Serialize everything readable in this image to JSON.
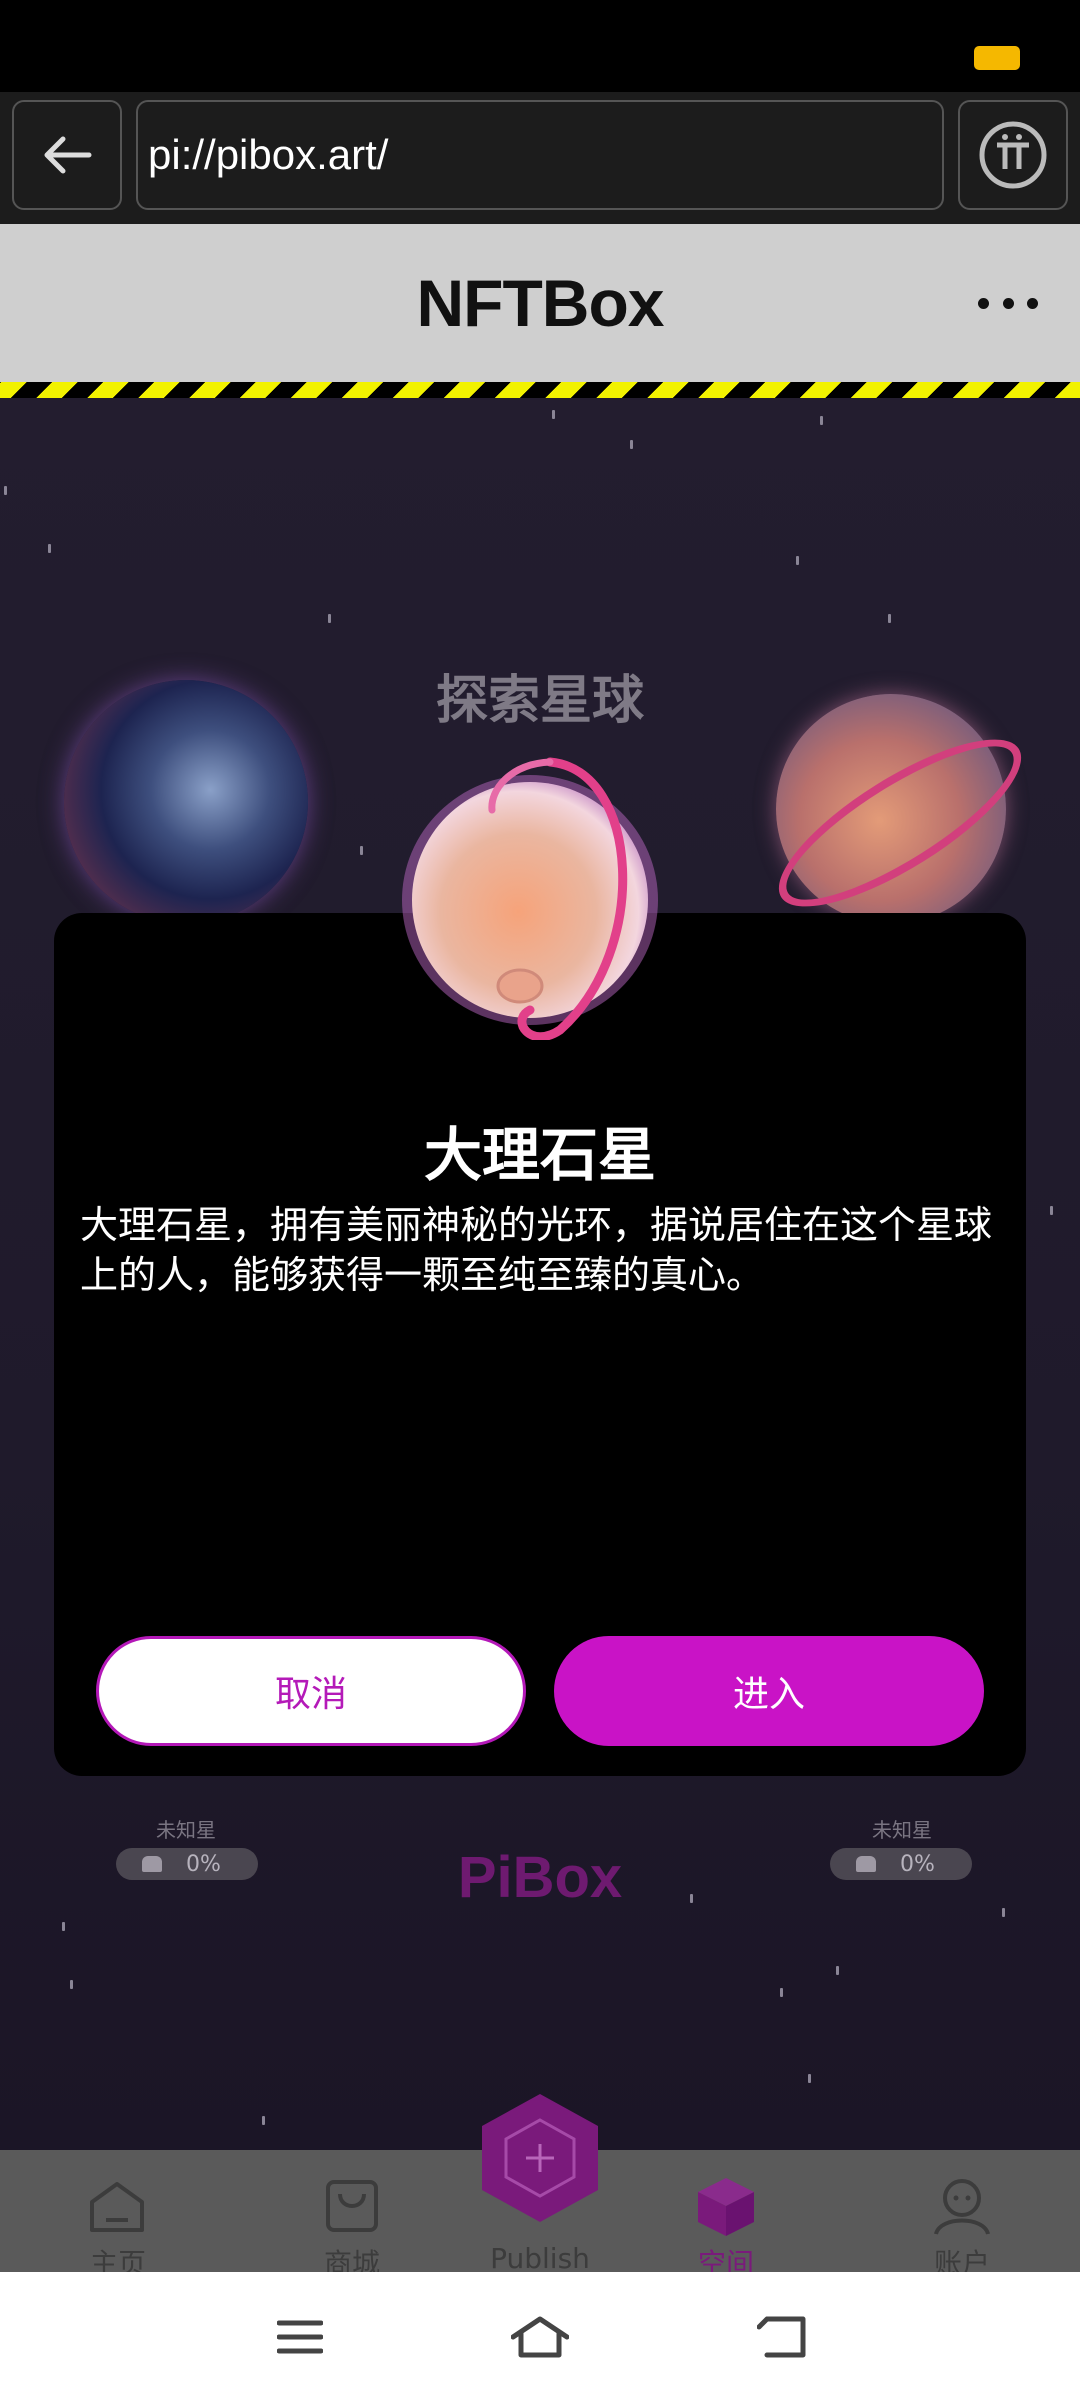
{
  "browser": {
    "url": "pi://pibox.art/"
  },
  "header": {
    "title": "NFTBox"
  },
  "space": {
    "section_title": "探索星球",
    "left_planet": {
      "label": "未知星",
      "progress": "0%"
    },
    "right_planet": {
      "label": "未知星",
      "progress": "0%"
    },
    "logo": "PiBox"
  },
  "modal": {
    "title": "大理石星",
    "description": "大理石星，拥有美丽神秘的光环，据说居住在这个星球上的人，能够获得一颗至纯至臻的真心。",
    "cancel_label": "取消",
    "enter_label": "进入"
  },
  "tabs": [
    {
      "label": "主页",
      "icon": "home-icon"
    },
    {
      "label": "商城",
      "icon": "shopping-bag-icon"
    },
    {
      "label": "Publish",
      "icon": "plus-hexagon-icon"
    },
    {
      "label": "空间",
      "icon": "cube-icon",
      "active": true
    },
    {
      "label": "账户",
      "icon": "user-icon"
    }
  ],
  "colors": {
    "accent": "#c913c6",
    "header_bg": "#cfcfcf",
    "space_bg": "#231d2f"
  }
}
